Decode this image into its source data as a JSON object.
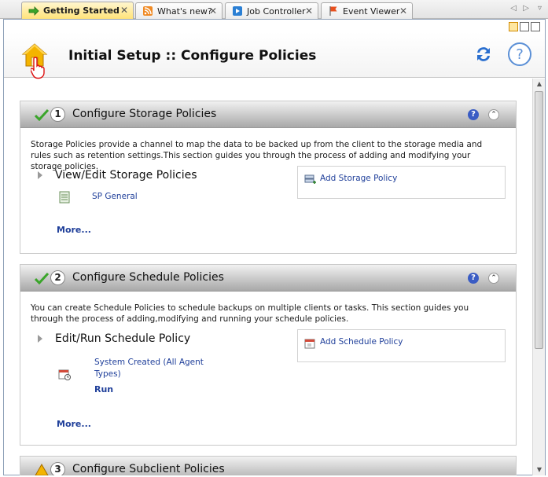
{
  "tabs": [
    {
      "label": "Getting Started",
      "active": true
    },
    {
      "label": "What's new?",
      "active": false
    },
    {
      "label": "Job Controller",
      "active": false
    },
    {
      "label": "Event Viewer",
      "active": false
    }
  ],
  "tab_close_glyph": "✕",
  "tab_nav": {
    "left": "◁",
    "right": "▷",
    "menu": "▿"
  },
  "header": {
    "title": "Initial Setup :: Configure Policies"
  },
  "help_glyph": "?",
  "collapse_glyph": "⌃",
  "sections": [
    {
      "number": "1",
      "title": "Configure Storage Policies",
      "description": "Storage Policies provide a channel to map the data to be backed up from the client to the storage media and rules such as retention settings.This section guides you through the process of adding and modifying your storage policies.",
      "subtitle": "View/Edit Storage Policies",
      "item": "SP General",
      "more": "More...",
      "action": "Add Storage Policy"
    },
    {
      "number": "2",
      "title": "Configure Schedule Policies",
      "description": "You can create Schedule Policies to schedule backups on multiple clients or tasks. This section guides you through the process of adding,modifying and running your schedule policies.",
      "subtitle": "Edit/Run Schedule Policy",
      "item": "System Created (All Agent Types)",
      "run": "Run",
      "more": "More...",
      "action": "Add Schedule Policy"
    },
    {
      "number": "3",
      "title": "Configure Subclient Policies"
    }
  ],
  "colors": {
    "accent": "#ffe37a",
    "link": "#1f3f9a",
    "check": "#3aa52a"
  }
}
